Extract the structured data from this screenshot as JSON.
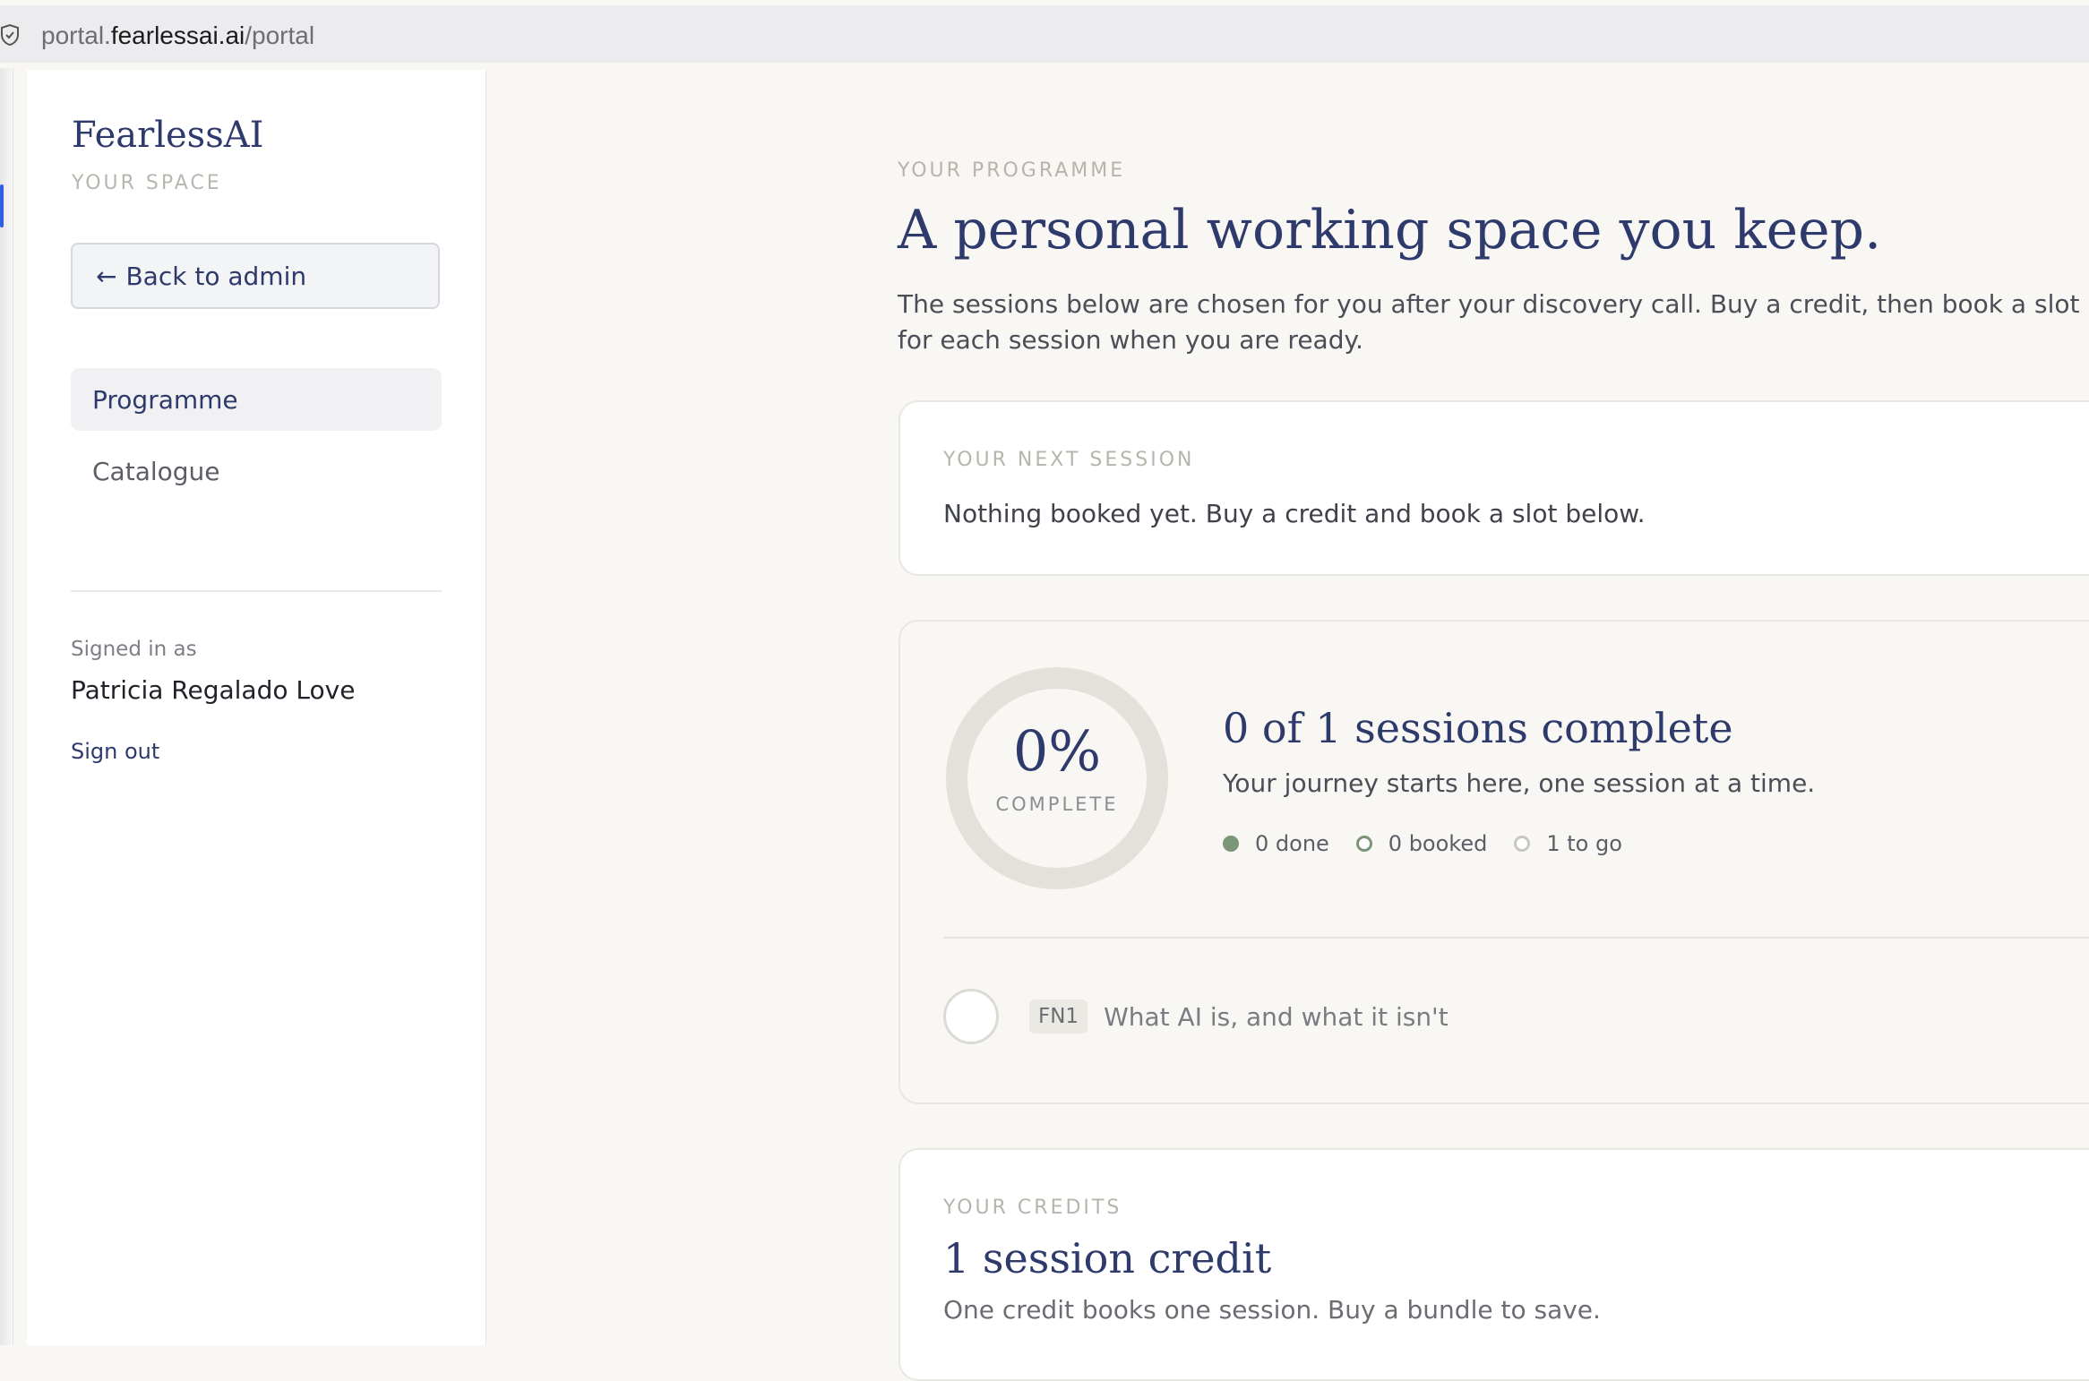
{
  "browser": {
    "url_prefix": "portal.",
    "url_host": "fearlessai.ai",
    "url_path": "/portal"
  },
  "sidebar": {
    "brand": "FearlessAI",
    "brand_sub": "YOUR SPACE",
    "back_label": "Back to admin",
    "nav": [
      {
        "label": "Programme",
        "active": true
      },
      {
        "label": "Catalogue",
        "active": false
      }
    ],
    "signed_in_label": "Signed in as",
    "user_name": "Patricia Regalado Love",
    "sign_out": "Sign out"
  },
  "main": {
    "eyebrow": "YOUR PROGRAMME",
    "title": "A personal working space you keep.",
    "description": "The sessions below are chosen for you after your discovery call. Buy a credit, then book a slot for each session when you are ready."
  },
  "next_session": {
    "eyebrow": "YOUR NEXT SESSION",
    "text": "Nothing booked yet. Buy a credit and book a slot below."
  },
  "progress": {
    "percent_text": "0%",
    "percent_value": 0,
    "complete_label": "COMPLETE",
    "title": "0 of 1 sessions complete",
    "subtitle": "Your journey starts here, one session at a time.",
    "legend": {
      "done": "0 done",
      "booked": "0 booked",
      "to_go": "1 to go"
    },
    "sessions": [
      {
        "code": "FN1",
        "title": "What AI is, and what it isn't"
      }
    ]
  },
  "credits": {
    "eyebrow": "YOUR CREDITS",
    "title": "1 session credit",
    "subtitle": "One credit books one session. Buy a bundle to save."
  },
  "colors": {
    "brand": "#2e3a6b",
    "done_green": "#7b9579",
    "page_bg": "#f8f7f4"
  }
}
